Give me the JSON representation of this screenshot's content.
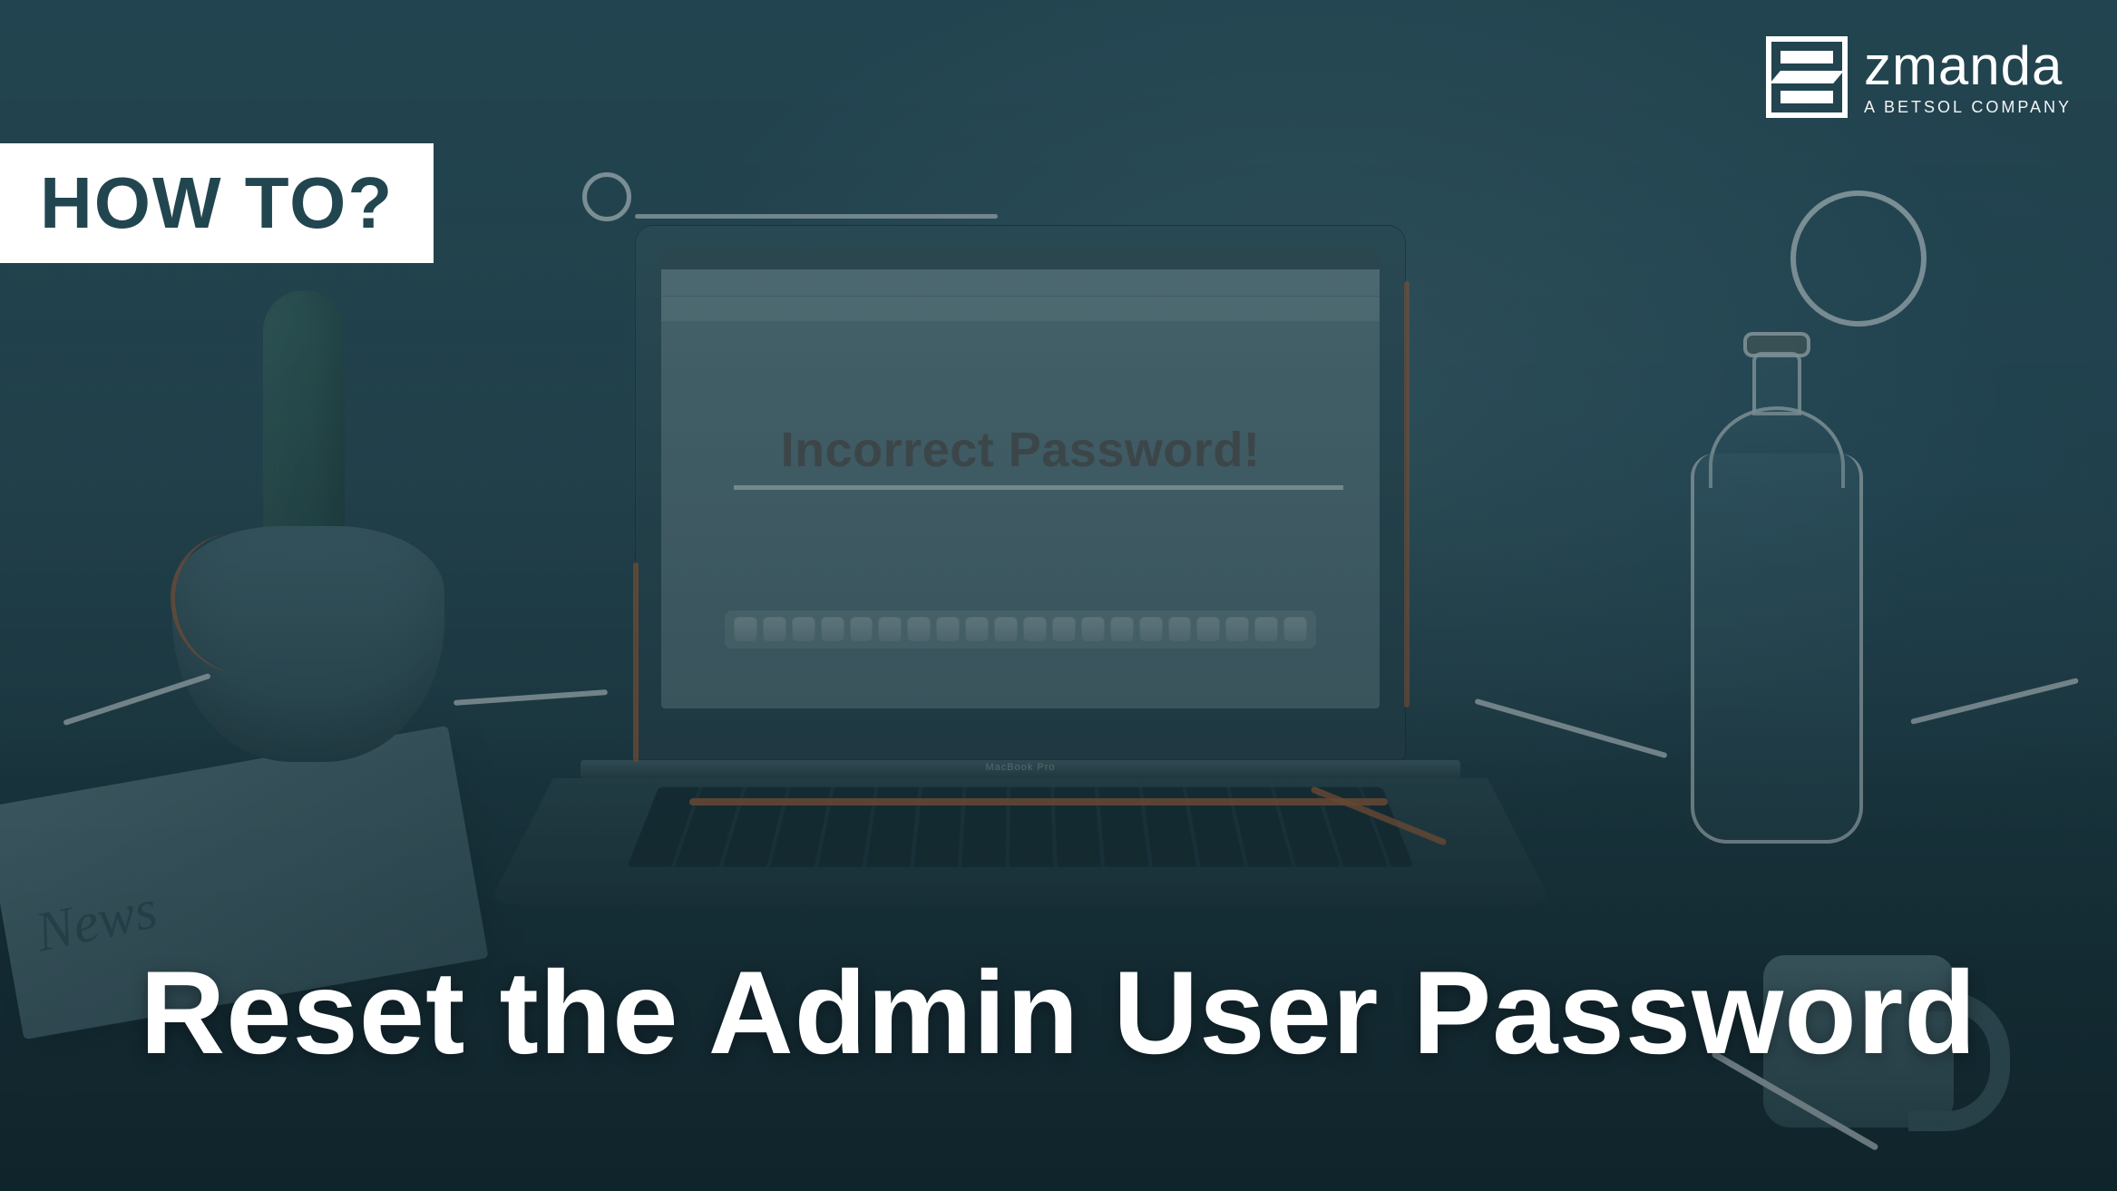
{
  "badge": {
    "label": "HOW TO?"
  },
  "brand": {
    "name": "zmanda",
    "tagline": "A BETSOL COMPANY"
  },
  "laptop": {
    "model_label": "MacBook Pro",
    "screen_message": "Incorrect Password!"
  },
  "paper": {
    "masthead": "News"
  },
  "headline": "Reset the Admin User Password"
}
